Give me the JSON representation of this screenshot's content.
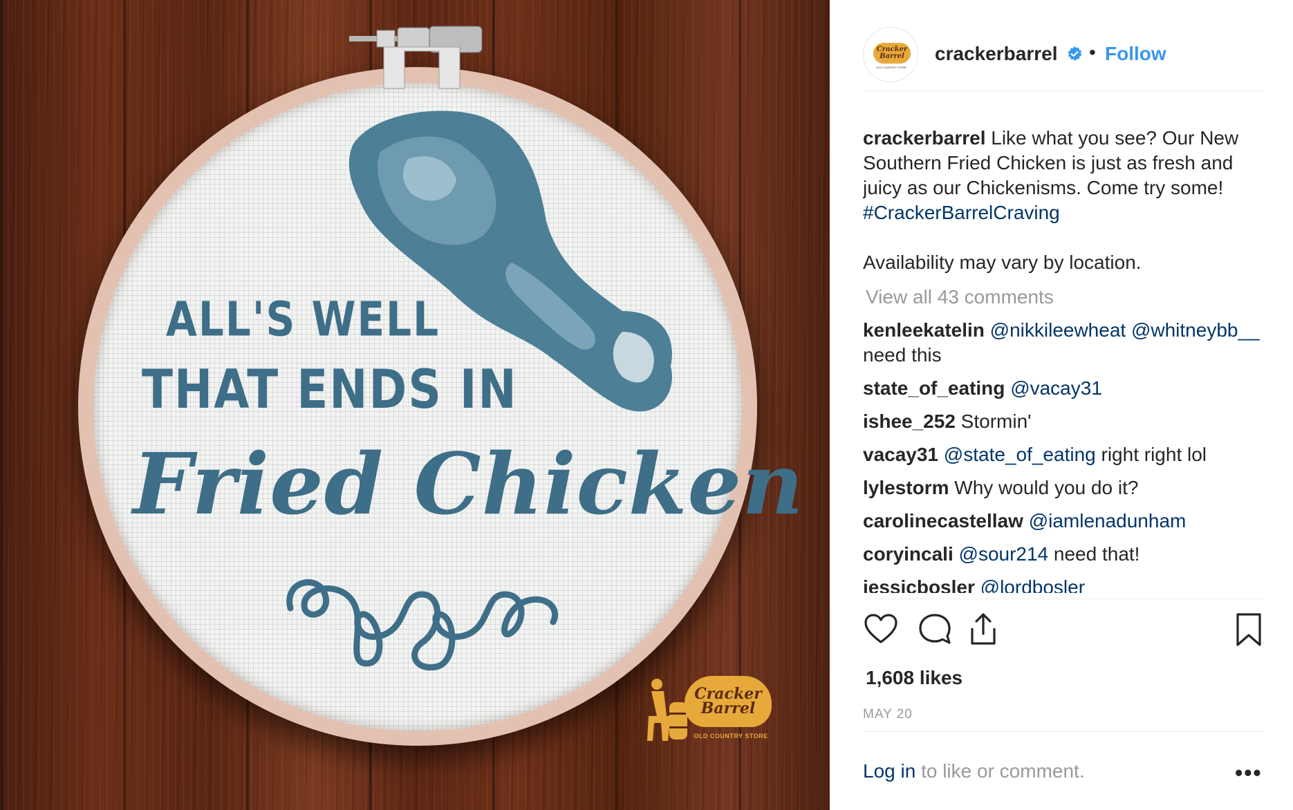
{
  "post": {
    "image": {
      "embroidery_line1": "ALL'S WELL",
      "embroidery_line2": "THAT ENDS IN",
      "embroidery_script": "Fried Chicken",
      "logo_text": "Cracker Barrel",
      "logo_subtext": "OLD COUNTRY STORE",
      "colors": {
        "thread": "#3e6e88",
        "wood": "#6b2e18",
        "hoop": "#e2bfae",
        "logo": "#e7a93a"
      }
    },
    "header": {
      "avatar_text": "Cracker Barrel",
      "avatar_subtext": "OLD COUNTRY STORE",
      "username": "crackerbarrel",
      "verified_icon": "verified-badge-icon",
      "separator": "•",
      "follow_label": "Follow"
    },
    "caption": {
      "username": "crackerbarrel",
      "text": "Like what you see? Our New Southern Fried Chicken is just as fresh and juicy as our Chickenisms. Come try some!",
      "hashtag": "#CrackerBarrelCraving",
      "availability": "Availability may vary by location."
    },
    "view_all_comments": "View all 43 comments",
    "comments": [
      {
        "user": "kenleekatelin",
        "mention": "@nikkileewheat",
        "mention2": "@whitneybb__",
        "text": "need this"
      },
      {
        "user": "state_of_eating",
        "mention": "@vacay31",
        "text": ""
      },
      {
        "user": "ishee_252",
        "mention": "",
        "text": "Stormin'"
      },
      {
        "user": "vacay31",
        "mention": "@state_of_eating",
        "text": "right right lol"
      },
      {
        "user": "lylestorm",
        "mention": "",
        "text": "Why would you do it?"
      },
      {
        "user": "carolinecastellaw",
        "mention": "@iamlenadunham",
        "text": ""
      },
      {
        "user": "coryincali",
        "mention": "@sour214",
        "text": "need that!"
      },
      {
        "user": "jessicbosler",
        "mention": "@lordbosler",
        "text": ""
      }
    ],
    "actions": {
      "like_icon": "heart-icon",
      "comment_icon": "comment-icon",
      "share_icon": "share-icon",
      "save_icon": "bookmark-icon"
    },
    "likes": "1,608 likes",
    "date": "MAY 20",
    "login": {
      "link": "Log in",
      "rest": "to like or comment."
    },
    "more_label": "•••",
    "colors": {
      "accent": "#3897f0",
      "link": "#003569",
      "muted": "#999999",
      "text": "#262626"
    }
  }
}
